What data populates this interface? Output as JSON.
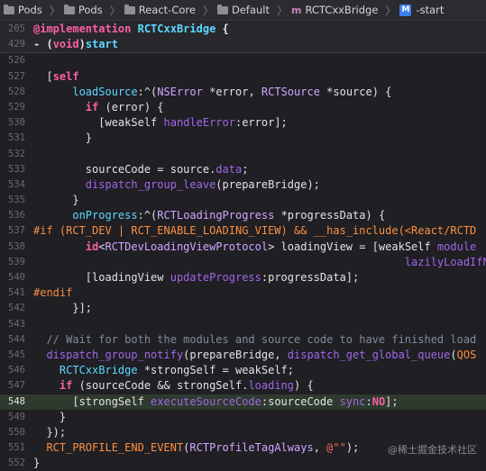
{
  "breadcrumb": {
    "items": [
      "Pods",
      "Pods",
      "React-Core",
      "Default",
      "RCTCxxBridge",
      "-start"
    ],
    "m_glyph": "m",
    "m_badge": "M"
  },
  "lines": [
    {
      "n": "205",
      "sticky": true,
      "segs": [
        [
          "kw",
          "@implementation"
        ],
        [
          "plain",
          " "
        ],
        [
          "cls",
          "RCTCxxBridge"
        ],
        [
          "plain",
          " {"
        ]
      ]
    },
    {
      "n": "429",
      "sticky": true,
      "segs": [
        [
          "plain",
          "- ("
        ],
        [
          "kw",
          "void"
        ],
        [
          "plain",
          ")"
        ],
        [
          "cls",
          "start"
        ]
      ]
    },
    {
      "n": "526",
      "segs": []
    },
    {
      "n": "527",
      "segs": [
        [
          "plain",
          "  ["
        ],
        [
          "kw",
          "self"
        ]
      ]
    },
    {
      "n": "528",
      "segs": [
        [
          "plain",
          "      "
        ],
        [
          "cls",
          "loadSource"
        ],
        [
          "plain",
          ":^("
        ],
        [
          "ty",
          "NSError"
        ],
        [
          "plain",
          " *error, "
        ],
        [
          "ty",
          "RCTSource"
        ],
        [
          "plain",
          " *source) {"
        ]
      ]
    },
    {
      "n": "529",
      "segs": [
        [
          "plain",
          "        "
        ],
        [
          "kw",
          "if"
        ],
        [
          "plain",
          " (error) {"
        ]
      ]
    },
    {
      "n": "530",
      "segs": [
        [
          "plain",
          "          [weakSelf "
        ],
        [
          "fn",
          "handleError"
        ],
        [
          "plain",
          ":error];"
        ]
      ]
    },
    {
      "n": "531",
      "segs": [
        [
          "plain",
          "        }"
        ]
      ]
    },
    {
      "n": "532",
      "segs": []
    },
    {
      "n": "533",
      "segs": [
        [
          "plain",
          "        sourceCode = source."
        ],
        [
          "prop",
          "data"
        ],
        [
          "plain",
          ";"
        ]
      ]
    },
    {
      "n": "534",
      "segs": [
        [
          "plain",
          "        "
        ],
        [
          "fn",
          "dispatch_group_leave"
        ],
        [
          "plain",
          "(prepareBridge);"
        ]
      ]
    },
    {
      "n": "535",
      "segs": [
        [
          "plain",
          "      }"
        ]
      ]
    },
    {
      "n": "536",
      "segs": [
        [
          "plain",
          "      "
        ],
        [
          "cls",
          "onProgress"
        ],
        [
          "plain",
          ":^("
        ],
        [
          "ty",
          "RCTLoadingProgress"
        ],
        [
          "plain",
          " *progressData) {"
        ]
      ]
    },
    {
      "n": "537",
      "segs": [
        [
          "mac",
          "#if (RCT_DEV | RCT_ENABLE_LOADING_VIEW) && __has_include(<React/RCTD"
        ]
      ]
    },
    {
      "n": "538",
      "segs": [
        [
          "plain",
          "        "
        ],
        [
          "kw",
          "id"
        ],
        [
          "plain",
          "<"
        ],
        [
          "ty",
          "RCTDevLoadingViewProtocol"
        ],
        [
          "plain",
          "> loadingView = [weakSelf "
        ],
        [
          "fn",
          "module"
        ]
      ]
    },
    {
      "n": "539",
      "segs": [
        [
          "plain",
          "                                                         "
        ],
        [
          "fn",
          "lazilyLoadIfNe"
        ]
      ]
    },
    {
      "n": "540",
      "segs": [
        [
          "plain",
          "        [loadingView "
        ],
        [
          "fn",
          "updateProgress"
        ],
        [
          "plain",
          ":progressData];"
        ]
      ]
    },
    {
      "n": "541",
      "segs": [
        [
          "mac",
          "#endif"
        ]
      ]
    },
    {
      "n": "542",
      "segs": [
        [
          "plain",
          "      }];"
        ]
      ]
    },
    {
      "n": "543",
      "segs": []
    },
    {
      "n": "544",
      "segs": [
        [
          "cmt",
          "  // Wait for both the modules and source code to have finished load"
        ]
      ]
    },
    {
      "n": "545",
      "segs": [
        [
          "plain",
          "  "
        ],
        [
          "fn",
          "dispatch_group_notify"
        ],
        [
          "plain",
          "(prepareBridge, "
        ],
        [
          "fn",
          "dispatch_get_global_queue"
        ],
        [
          "plain",
          "("
        ],
        [
          "mac",
          "QOS"
        ]
      ]
    },
    {
      "n": "546",
      "segs": [
        [
          "plain",
          "    "
        ],
        [
          "cls",
          "RCTCxxBridge"
        ],
        [
          "plain",
          " *strongSelf = weakSelf;"
        ]
      ]
    },
    {
      "n": "547",
      "segs": [
        [
          "plain",
          "    "
        ],
        [
          "kw",
          "if"
        ],
        [
          "plain",
          " (sourceCode && strongSelf."
        ],
        [
          "prop",
          "loading"
        ],
        [
          "plain",
          ") {"
        ]
      ]
    },
    {
      "n": "548",
      "hl": true,
      "segs": [
        [
          "plain",
          "      [strongSelf "
        ],
        [
          "fn",
          "executeSourceCode"
        ],
        [
          "plain",
          ":sourceCode "
        ],
        [
          "fn",
          "sync"
        ],
        [
          "plain",
          ":"
        ],
        [
          "kw",
          "NO"
        ],
        [
          "plain",
          "];"
        ]
      ]
    },
    {
      "n": "549",
      "segs": [
        [
          "plain",
          "    }"
        ]
      ]
    },
    {
      "n": "550",
      "segs": [
        [
          "plain",
          "  });"
        ]
      ]
    },
    {
      "n": "551",
      "segs": [
        [
          "plain",
          "  "
        ],
        [
          "mac",
          "RCT_PROFILE_END_EVENT"
        ],
        [
          "plain",
          "("
        ],
        [
          "ty",
          "RCTProfileTagAlways"
        ],
        [
          "plain",
          ", "
        ],
        [
          "str",
          "@\"\""
        ],
        [
          "plain",
          ");"
        ]
      ]
    },
    {
      "n": "552",
      "segs": [
        [
          "plain",
          "}"
        ]
      ]
    }
  ],
  "watermark": "@稀土掘金技术社区",
  "colors": {
    "background": "#1f1f24",
    "keyword": "#fc5fa3",
    "class": "#5dd8ff",
    "type": "#d0a8ff",
    "function": "#a167e6",
    "macro": "#fd8f3f",
    "string": "#fc6a5d",
    "comment": "#7f8c98"
  }
}
